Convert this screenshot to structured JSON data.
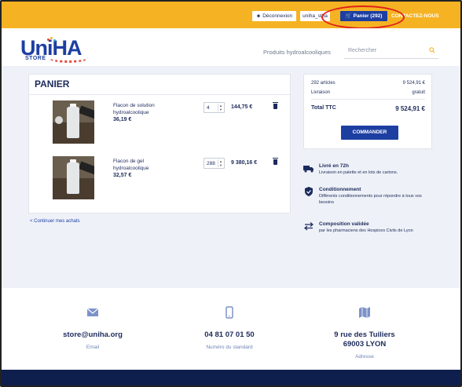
{
  "topbar": {
    "logout_label": "Déconnexion",
    "user_label": "uniha_stha",
    "cart_label": "Panier (292)",
    "contact_label": "CONTACTEZ-NOUS",
    "colors": {
      "bar": "#f5b323",
      "cart_button": "#1d3fa2",
      "highlight_circle": "#e0201b"
    }
  },
  "header": {
    "logo_text": "UniHA",
    "logo_sub": "STORE",
    "nav_link": "Produits hydroalcooliques",
    "search_placeholder": "Rechercher"
  },
  "panier": {
    "title": "PANIER",
    "items": [
      {
        "name": "Flacon de solution hydroalcoolique",
        "unit_price": "36,19 €",
        "qty": "4",
        "total": "144,75 €"
      },
      {
        "name": "Flacon de gel hydroalcoolique",
        "unit_price": "32,57 €",
        "qty": "288",
        "total": "9 380,16 €"
      }
    ],
    "continue_label": "< Continuer mes achats"
  },
  "summary": {
    "articles_label": "292 articles",
    "articles_value": "9 524,91 €",
    "livraison_label": "Livraison",
    "livraison_value": "gratuit",
    "total_label": "Total TTC",
    "total_value": "9 524,91 €",
    "button_label": "COMMANDER"
  },
  "features": [
    {
      "icon": "truck-icon",
      "title": "Livré en 72h",
      "desc": "Livraison en palette et en lots de cartons."
    },
    {
      "icon": "shield-check-icon",
      "title": "Conditionnement",
      "desc": "Différents conditionnements pour répondre à tous vos besoins"
    },
    {
      "icon": "arrows-exchange-icon",
      "title": "Composition validée",
      "desc": "par les pharmaciens des Hospices Civils de Lyon"
    }
  ],
  "contact": {
    "email": "store@uniha.org",
    "email_sub": "Email",
    "phone": "04 81 07 01 50",
    "phone_sub": "Numéro du standard",
    "address_line1": "9 rue des Tuiliers",
    "address_line2": "69003 LYON",
    "address_sub": "Adresse"
  }
}
